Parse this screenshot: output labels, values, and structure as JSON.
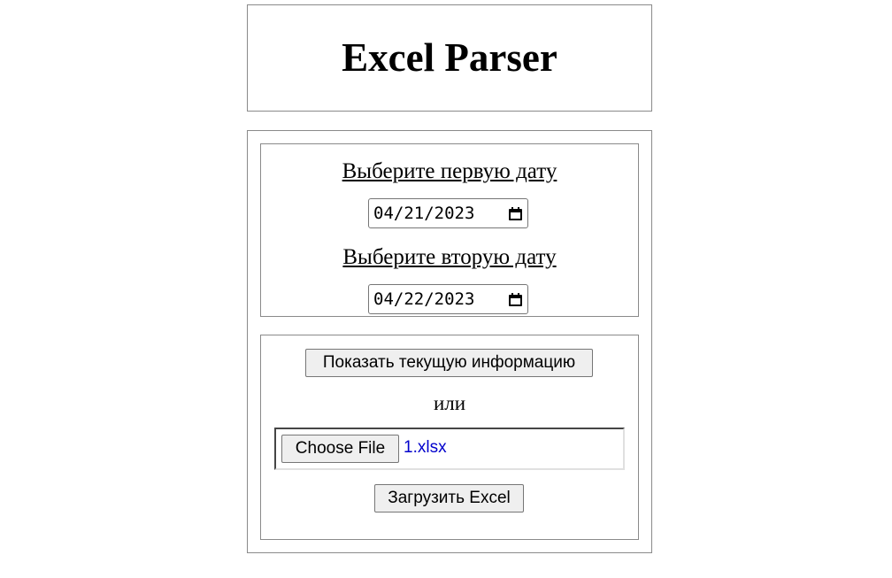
{
  "header": {
    "title": "Excel Parser"
  },
  "dates": {
    "first_label": "Выберите первую дату",
    "first_value": "04/21/2023",
    "second_label": "Выберите вторую дату",
    "second_value": "04/22/2023"
  },
  "actions": {
    "show_button_label": "Показать текущую информацию",
    "or_text": "или",
    "choose_file_label": "Choose File",
    "selected_file": "1.xlsx",
    "upload_button_label": "Загрузить Excel"
  },
  "icons": {
    "date_picker": "calendar-icon"
  },
  "colors": {
    "file_name": "#0000cc",
    "border": "#8a8a8a",
    "button_bg": "#efefef"
  }
}
